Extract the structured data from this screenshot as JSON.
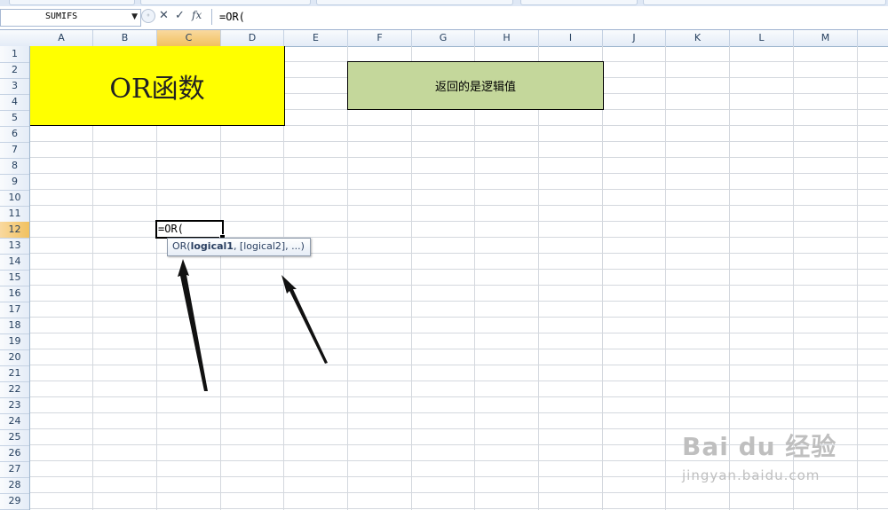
{
  "formula_bar": {
    "name_box": "SUMIFS",
    "cancel_symbol": "✕",
    "enter_symbol": "✓",
    "fx_label": "fx",
    "formula": "=OR("
  },
  "columns": [
    "A",
    "B",
    "C",
    "D",
    "E",
    "F",
    "G",
    "H",
    "I",
    "J",
    "K",
    "L",
    "M"
  ],
  "selected_column": "C",
  "rows": [
    "1",
    "2",
    "3",
    "4",
    "5",
    "6",
    "7",
    "8",
    "9",
    "10",
    "11",
    "12",
    "13",
    "14",
    "15",
    "16",
    "17",
    "18",
    "19",
    "20",
    "21",
    "22",
    "23",
    "24",
    "25",
    "26",
    "27",
    "28",
    "29"
  ],
  "selected_row": "12",
  "cells": {
    "title_merged": "OR函数",
    "note_merged": "返回的是逻辑值",
    "active_cell_text": "=OR("
  },
  "tooltip": {
    "func": "OR(",
    "arg_bold": "logical1",
    "rest": ", [logical2], ...)"
  },
  "watermark": {
    "logo": "Bai du 经验",
    "url": "jingyan.baidu.com"
  },
  "colors": {
    "title_fill": "#ffff00",
    "note_fill": "#c4d79b",
    "header_selected": "#f1c15f",
    "gridline": "#d4d8de"
  }
}
